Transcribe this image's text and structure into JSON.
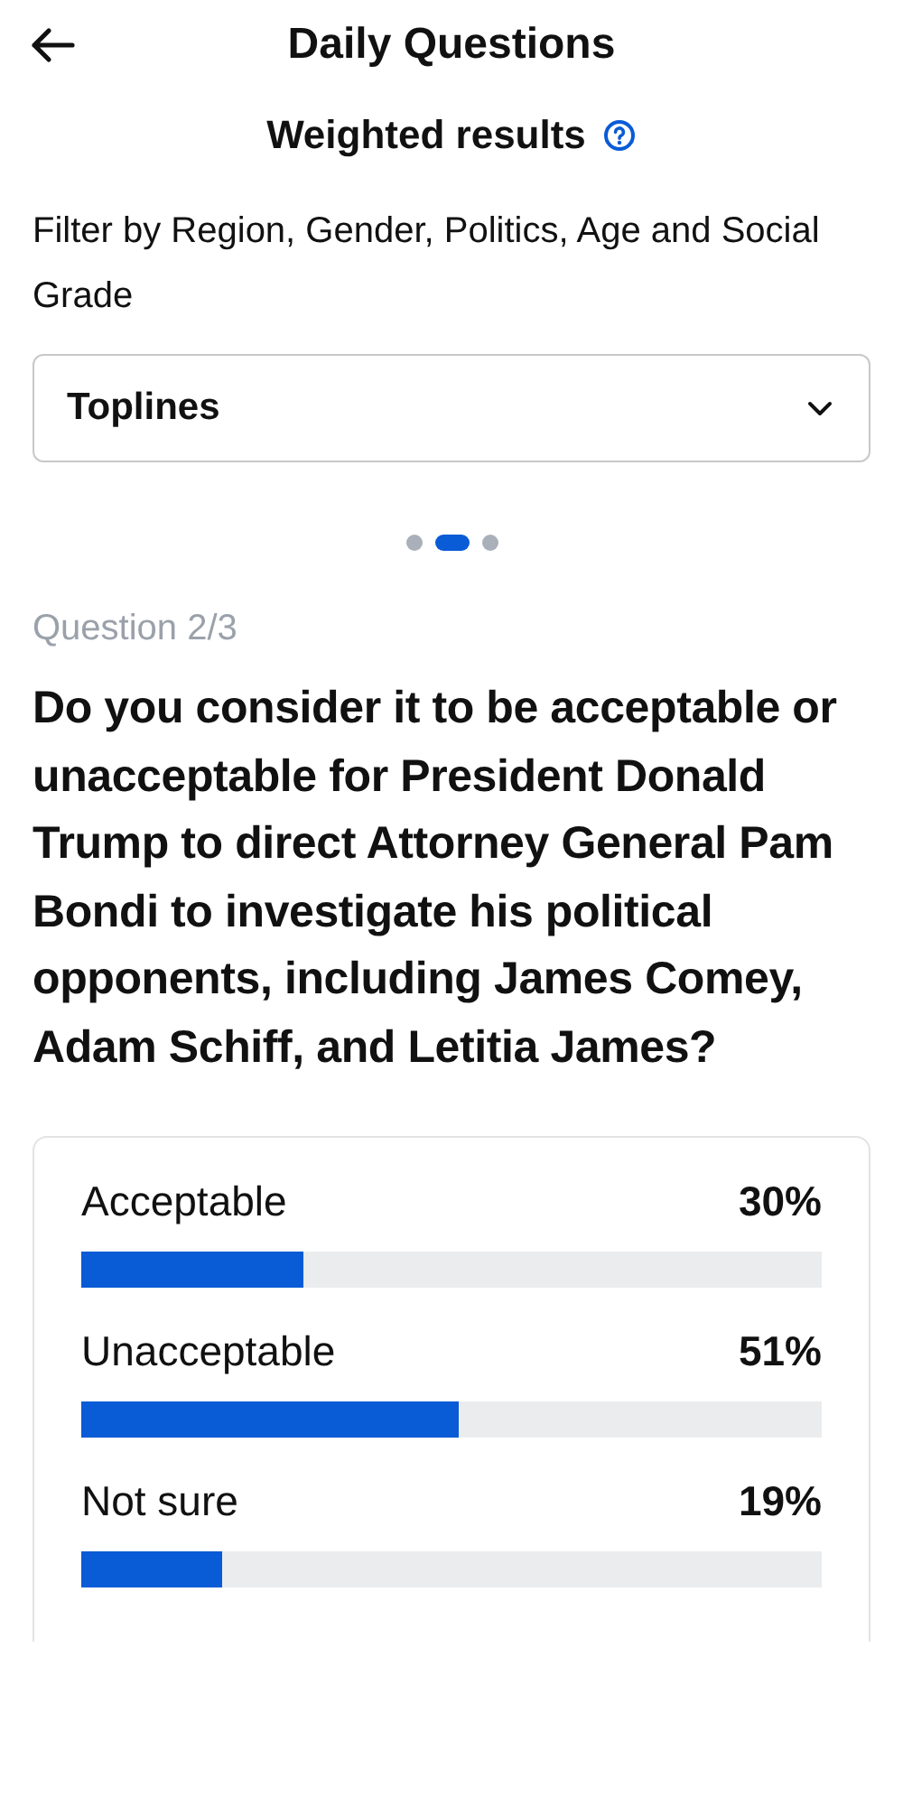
{
  "header": {
    "title": "Daily Questions"
  },
  "subtitle": {
    "text": "Weighted results"
  },
  "filter": {
    "text": "Filter by Region, Gender, Politics, Age and Social Grade",
    "dropdown": "Toplines"
  },
  "pager": [
    {
      "selected": false
    },
    {
      "selected": true
    },
    {
      "selected": false
    }
  ],
  "question": {
    "label": "Question 2/3",
    "text": "Do you consider it to be acceptable or unacceptable for President Donald Trump to direct Attorney General Pam Bondi to investigate his political opponents, including James Comey, Adam Schiff, and Letitia James?"
  },
  "results": [
    {
      "label": "Acceptable",
      "value": "30%",
      "level": 0.3
    },
    {
      "label": "Unacceptable",
      "value": "51%",
      "level": 0.51
    },
    {
      "label": "Not sure",
      "value": "19%",
      "level": 0.19
    }
  ]
}
